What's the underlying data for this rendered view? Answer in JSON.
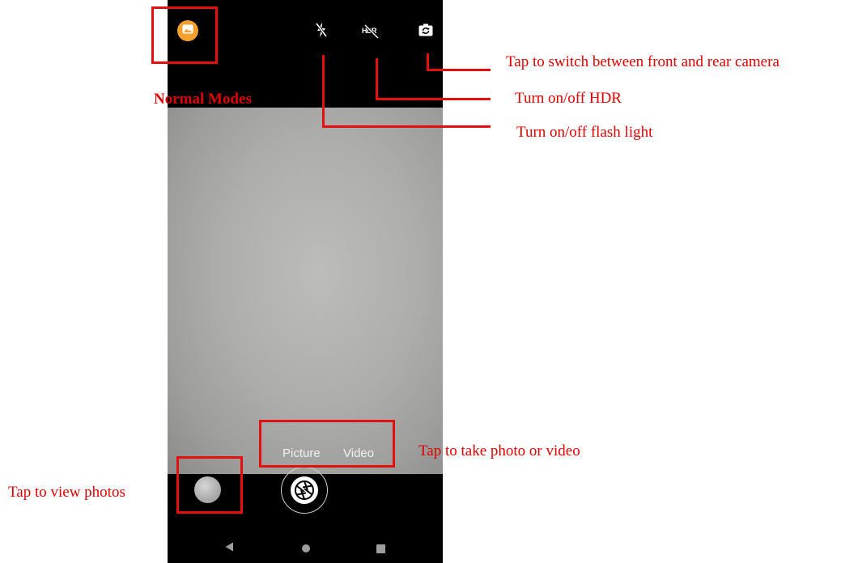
{
  "camera": {
    "top_bar": {
      "gallery_icon": "image-icon",
      "flash_icon": "flash-off-icon",
      "hdr_icon": "hdr-off-icon",
      "hdr_text": "HDR",
      "switch_icon": "camera-switch-icon"
    },
    "modes": [
      {
        "label": "Picture"
      },
      {
        "label": "Video"
      }
    ],
    "bottom": {
      "thumbnail_icon": "photo-thumbnail-icon",
      "shutter_icon": "shutter-icon"
    },
    "nav": {
      "back_icon": "back-triangle-icon",
      "home_icon": "home-circle-icon",
      "recents_icon": "recents-square-icon"
    }
  },
  "annotations": {
    "normal_modes": "Normal Modes",
    "switch_camera": "Tap to switch between front and rear camera",
    "hdr": "Turn on/off HDR",
    "flash": "Turn on/off flash light",
    "take_photo_video": "Tap to take photo or video",
    "view_photos": "Tap to view photos"
  },
  "colors": {
    "annotation": "#e00000",
    "gallery_accent": "#f5a02a",
    "phone_bg": "#000000"
  }
}
